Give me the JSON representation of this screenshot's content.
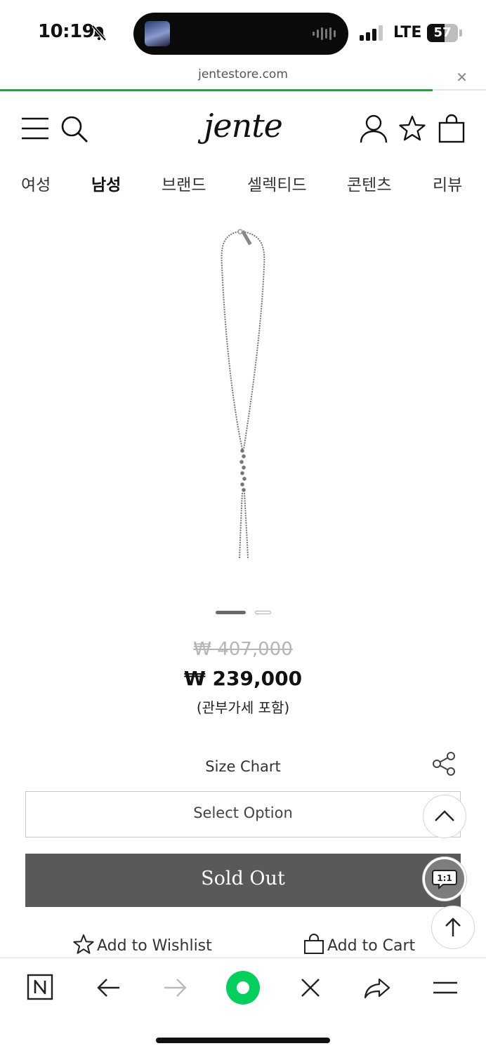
{
  "status_bar": {
    "time": "10:19",
    "network": "LTE",
    "battery": "57",
    "battery_level_percent": 57
  },
  "browser": {
    "url": "jentestore.com",
    "load_progress_percent": 89
  },
  "header": {
    "logo": "jente"
  },
  "categories": [
    {
      "label": "여성",
      "active": false
    },
    {
      "label": "남성",
      "active": true
    },
    {
      "label": "브랜드",
      "active": false
    },
    {
      "label": "셀렉티드",
      "active": false
    },
    {
      "label": "콘텐츠",
      "active": false
    },
    {
      "label": "리뷰",
      "active": false
    }
  ],
  "carousel": {
    "total": 2,
    "current": 1
  },
  "product": {
    "original_price": "₩ 407,000",
    "sale_price": "₩ 239,000",
    "tax_note": "(관부가세 포함)"
  },
  "size_chart_label": "Size Chart",
  "option_select": {
    "placeholder": "Select Option"
  },
  "sold_out_label": "Sold Out",
  "chat_label": "1:1",
  "actions": {
    "wishlist": "Add to Wishlist",
    "cart": "Add to Cart"
  },
  "colors": {
    "accent_green": "#1fa53a",
    "sold_out_bg": "#595959",
    "naver_green": "#03cf5d"
  }
}
